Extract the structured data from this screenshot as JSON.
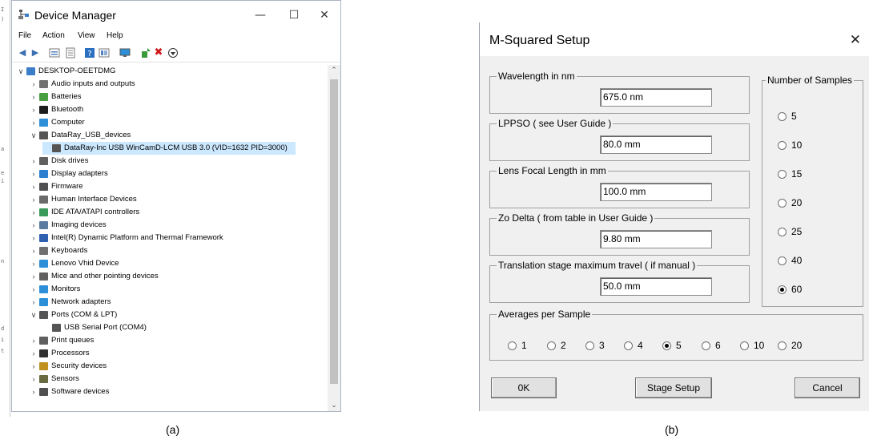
{
  "device_manager": {
    "title": "Device Manager",
    "window_controls": {
      "minimize": "—",
      "maximize": "☐",
      "close": "✕"
    },
    "menu": [
      "File",
      "Action",
      "View",
      "Help"
    ],
    "toolbar_icons": [
      "back-icon",
      "forward-icon",
      "tree-view-icon",
      "properties-icon",
      "help-icon",
      "details-icon",
      "monitor-icon",
      "update-driver-icon",
      "uninstall-icon",
      "download-icon"
    ],
    "tree": [
      {
        "label": "DESKTOP-OEETDMG",
        "level": 0,
        "expander": "expanded",
        "icon_color": "#3b7dc8",
        "selected": false
      },
      {
        "label": "Audio inputs and outputs",
        "level": 1,
        "expander": "collapsed",
        "icon_color": "#707070",
        "selected": false
      },
      {
        "label": "Batteries",
        "level": 1,
        "expander": "collapsed",
        "icon_color": "#4aa040",
        "selected": false
      },
      {
        "label": "Bluetooth",
        "level": 1,
        "expander": "collapsed",
        "icon_color": "#1c1c1c",
        "selected": false
      },
      {
        "label": "Computer",
        "level": 1,
        "expander": "collapsed",
        "icon_color": "#2d8fd8",
        "selected": false
      },
      {
        "label": "DataRay_USB_devices",
        "level": 1,
        "expander": "expanded",
        "icon_color": "#555555",
        "selected": false
      },
      {
        "label": "DataRay-Inc USB WinCamD-LCM USB 3.0 (VID=1632 PID=3000)",
        "level": 2,
        "expander": "none",
        "icon_color": "#555555",
        "selected": true
      },
      {
        "label": "Disk drives",
        "level": 1,
        "expander": "collapsed",
        "icon_color": "#606060",
        "selected": false
      },
      {
        "label": "Display adapters",
        "level": 1,
        "expander": "collapsed",
        "icon_color": "#2f7fd0",
        "selected": false
      },
      {
        "label": "Firmware",
        "level": 1,
        "expander": "collapsed",
        "icon_color": "#505050",
        "selected": false
      },
      {
        "label": "Human Interface Devices",
        "level": 1,
        "expander": "collapsed",
        "icon_color": "#6a6a6a",
        "selected": false
      },
      {
        "label": "IDE ATA/ATAPI controllers",
        "level": 1,
        "expander": "collapsed",
        "icon_color": "#3a9a5a",
        "selected": false
      },
      {
        "label": "Imaging devices",
        "level": 1,
        "expander": "collapsed",
        "icon_color": "#5a7aa0",
        "selected": false
      },
      {
        "label": "Intel(R) Dynamic Platform and Thermal Framework",
        "level": 1,
        "expander": "collapsed",
        "icon_color": "#3060b0",
        "selected": false
      },
      {
        "label": "Keyboards",
        "level": 1,
        "expander": "collapsed",
        "icon_color": "#707070",
        "selected": false
      },
      {
        "label": "Lenovo Vhid Device",
        "level": 1,
        "expander": "collapsed",
        "icon_color": "#2d8fd8",
        "selected": false
      },
      {
        "label": "Mice and other pointing devices",
        "level": 1,
        "expander": "collapsed",
        "icon_color": "#606060",
        "selected": false
      },
      {
        "label": "Monitors",
        "level": 1,
        "expander": "collapsed",
        "icon_color": "#2d8fd8",
        "selected": false
      },
      {
        "label": "Network adapters",
        "level": 1,
        "expander": "collapsed",
        "icon_color": "#2d8fd8",
        "selected": false
      },
      {
        "label": "Ports (COM & LPT)",
        "level": 1,
        "expander": "expanded",
        "icon_color": "#555555",
        "selected": false
      },
      {
        "label": "USB Serial Port (COM4)",
        "level": 2,
        "expander": "none",
        "icon_color": "#555555",
        "selected": false
      },
      {
        "label": "Print queues",
        "level": 1,
        "expander": "collapsed",
        "icon_color": "#606060",
        "selected": false
      },
      {
        "label": "Processors",
        "level": 1,
        "expander": "collapsed",
        "icon_color": "#303030",
        "selected": false
      },
      {
        "label": "Security devices",
        "level": 1,
        "expander": "collapsed",
        "icon_color": "#c09020",
        "selected": false
      },
      {
        "label": "Sensors",
        "level": 1,
        "expander": "collapsed",
        "icon_color": "#6a6a40",
        "selected": false
      },
      {
        "label": "Software devices",
        "level": 1,
        "expander": "collapsed",
        "icon_color": "#505050",
        "selected": false
      }
    ],
    "selected_color": "#cce8ff"
  },
  "msq": {
    "title": "M-Squared Setup",
    "close": "✕",
    "groups": [
      {
        "legend": "Wavelength in nm",
        "value": "675.0 nm"
      },
      {
        "legend": "LPPSO  ( see User Guide )",
        "value": "80.0 mm"
      },
      {
        "legend": "Lens Focal Length in mm",
        "value": "100.0 mm"
      },
      {
        "legend": "Zo Delta  ( from table in User Guide )",
        "value": "9.80 mm"
      },
      {
        "legend": "Translation stage maximum travel  ( if manual )",
        "value": "50.0 mm"
      }
    ],
    "samples": {
      "legend": "Number of Samples",
      "options": [
        "5",
        "10",
        "15",
        "20",
        "25",
        "40",
        "60"
      ],
      "selected": "60"
    },
    "averages": {
      "legend": "Averages per Sample",
      "options": [
        "1",
        "2",
        "3",
        "4",
        "5",
        "6",
        "10",
        "20"
      ],
      "selected": "5"
    },
    "buttons": {
      "ok": "0K",
      "stage_setup": "Stage Setup",
      "cancel": "Cancel"
    }
  },
  "captions": {
    "a": "(a)",
    "b": "(b)"
  }
}
